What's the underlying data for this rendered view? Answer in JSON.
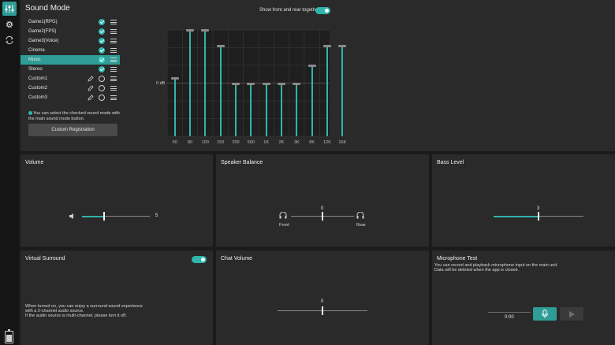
{
  "sound_mode": {
    "title": "Sound Mode",
    "show_together_label": "Show front and rear together",
    "show_together_on": true,
    "modes": [
      {
        "label": "Game1(RPG)",
        "state": "checked",
        "editable": false
      },
      {
        "label": "Game2(FPS)",
        "state": "checked",
        "editable": false
      },
      {
        "label": "Game3(Voice)",
        "state": "checked",
        "editable": false
      },
      {
        "label": "Cinema",
        "state": "checked",
        "editable": false
      },
      {
        "label": "Music",
        "state": "checked",
        "editable": false,
        "selected": true
      },
      {
        "label": "Stereo",
        "state": "checked",
        "editable": false
      },
      {
        "label": "Custom1",
        "state": "unchecked",
        "editable": true
      },
      {
        "label": "Custom2",
        "state": "unchecked",
        "editable": true
      },
      {
        "label": "Custom3",
        "state": "unchecked",
        "editable": true
      }
    ],
    "note": "You can select the checked sound mode with the main sound mode button.",
    "custom_registration": "Custom Registration"
  },
  "equalizer": {
    "zero_label": "0 dB",
    "bands": [
      {
        "freq": "50",
        "level": 0.55
      },
      {
        "freq": "80",
        "level": 1.0
      },
      {
        "freq": "100",
        "level": 1.0
      },
      {
        "freq": "150",
        "level": 0.85
      },
      {
        "freq": "200",
        "level": 0.5
      },
      {
        "freq": "500",
        "level": 0.5
      },
      {
        "freq": "1K",
        "level": 0.5
      },
      {
        "freq": "2K",
        "level": 0.5
      },
      {
        "freq": "3K",
        "level": 0.5
      },
      {
        "freq": "8K",
        "level": 0.67
      },
      {
        "freq": "12K",
        "level": 0.85
      },
      {
        "freq": "16K",
        "level": 0.85
      }
    ]
  },
  "volume": {
    "title": "Volume",
    "value": "5",
    "level": 0.33
  },
  "balance": {
    "title": "Speaker Balance",
    "value": "0",
    "front": "Front",
    "rear": "Rear"
  },
  "bass": {
    "title": "Bass Level",
    "value": "3",
    "level": 0.5
  },
  "surround": {
    "title": "Virtual Surround",
    "on": true,
    "desc1": "When turned on, you can enjoy a surround sound experience",
    "desc2": "with a 2-channel audio source.",
    "desc3": "If the audio source is multi-channel, please turn it off."
  },
  "chat": {
    "title": "Chat Volume",
    "value": "0"
  },
  "mic": {
    "title": "Microphone Test",
    "desc1": "You can record and playback microphone input on the main unit.",
    "desc2": "Data will be deleted when the app is closed.",
    "time": "0:00"
  },
  "colors": {
    "accent": "#2fb5ac",
    "selected": "#2f9c96",
    "panel": "#2a2a2a",
    "background": "#1b1b1b"
  }
}
